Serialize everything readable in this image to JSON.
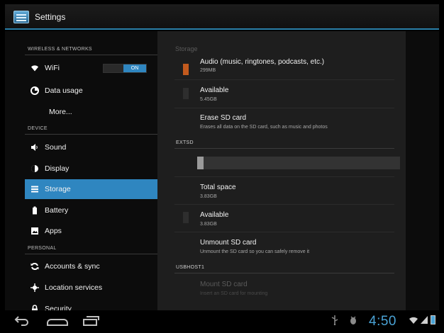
{
  "window": {
    "title": "Settings"
  },
  "sidebar": {
    "sections": [
      {
        "header": "WIRELESS & NETWORKS"
      },
      {
        "header": "DEVICE"
      },
      {
        "header": "PERSONAL"
      }
    ],
    "items": [
      {
        "label": "WiFi",
        "icon": "wifi-icon",
        "toggle": "ON"
      },
      {
        "label": "Data usage",
        "icon": "data-usage-icon"
      },
      {
        "label": "More..."
      },
      {
        "label": "Sound",
        "icon": "speaker-icon"
      },
      {
        "label": "Display",
        "icon": "brightness-icon"
      },
      {
        "label": "Storage",
        "icon": "storage-icon",
        "selected": true
      },
      {
        "label": "Battery",
        "icon": "battery-icon"
      },
      {
        "label": "Apps",
        "icon": "apps-icon"
      },
      {
        "label": "Accounts & sync",
        "icon": "sync-icon"
      },
      {
        "label": "Location services",
        "icon": "location-icon"
      },
      {
        "label": "Security",
        "icon": "lock-icon"
      }
    ]
  },
  "storage": {
    "title": "Storage",
    "audio": {
      "title": "Audio (music, ringtones, podcasts, etc.)",
      "size": "299MB",
      "color": "#c25a1e"
    },
    "available": {
      "title": "Available",
      "size": "5.45GB"
    },
    "erase": {
      "title": "Erase SD card",
      "subtitle": "Erases all data on the SD card, such as music and photos"
    },
    "extsd": {
      "header": "EXTSD",
      "usage_fraction": 0.01,
      "total": {
        "title": "Total space",
        "size": "3.83GB"
      },
      "available": {
        "title": "Available",
        "size": "3.83GB"
      },
      "unmount": {
        "title": "Unmount SD card",
        "subtitle": "Unmount the SD card so you can safely remove it"
      }
    },
    "usbhost": {
      "header": "USBHOST1",
      "mount": {
        "title": "Mount SD card",
        "subtitle": "Insert an SD card for mounting"
      }
    }
  },
  "statusbar": {
    "time": "4:50"
  },
  "colors": {
    "accent": "#2f86c0",
    "clock": "#4aa3d6"
  }
}
